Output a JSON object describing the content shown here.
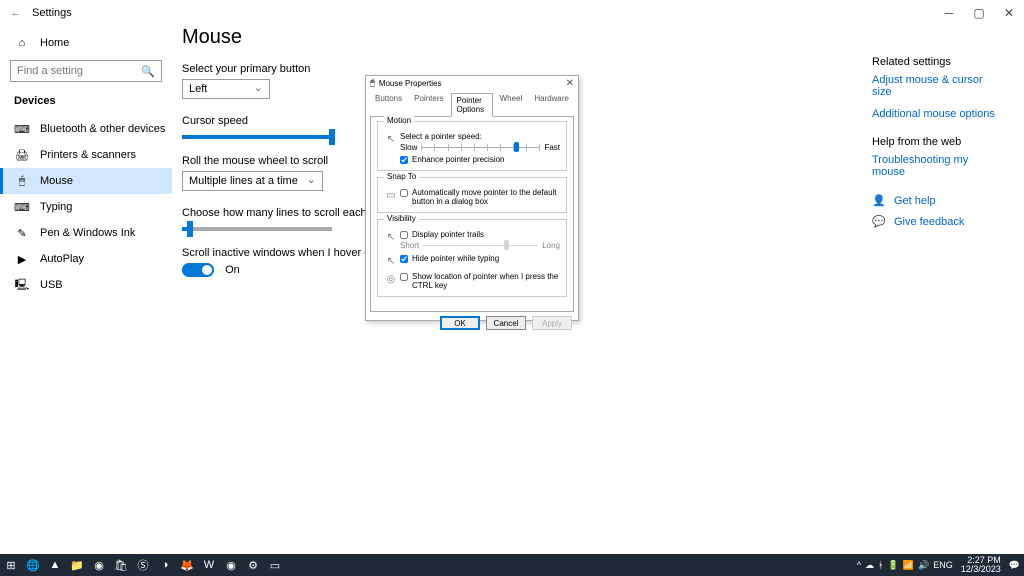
{
  "titlebar": {
    "title": "Settings"
  },
  "sidebar": {
    "home": "Home",
    "search_placeholder": "Find a setting",
    "section": "Devices",
    "items": [
      {
        "label": "Bluetooth & other devices",
        "icon": "⌨"
      },
      {
        "label": "Printers & scanners",
        "icon": "🖨"
      },
      {
        "label": "Mouse",
        "icon": "🖱",
        "active": true
      },
      {
        "label": "Typing",
        "icon": "⌨"
      },
      {
        "label": "Pen & Windows Ink",
        "icon": "✎"
      },
      {
        "label": "AutoPlay",
        "icon": "▶"
      },
      {
        "label": "USB",
        "icon": "🖳"
      }
    ]
  },
  "main": {
    "heading": "Mouse",
    "primary_btn_label": "Select your primary button",
    "primary_btn_value": "Left",
    "cursor_speed_label": "Cursor speed",
    "cursor_speed_value": 98,
    "scroll_wheel_label": "Roll the mouse wheel to scroll",
    "scroll_wheel_value": "Multiple lines at a time",
    "lines_label": "Choose how many lines to scroll each time",
    "lines_value": 3,
    "inactive_label": "Scroll inactive windows when I hover over them",
    "inactive_on": "On"
  },
  "right": {
    "related_head": "Related settings",
    "adjust_link": "Adjust mouse & cursor size",
    "additional_link": "Additional mouse options",
    "help_head": "Help from the web",
    "troubleshoot": "Troubleshooting my mouse",
    "get_help": "Get help",
    "feedback": "Give feedback"
  },
  "dialog": {
    "title": "Mouse Properties",
    "tabs": [
      "Buttons",
      "Pointers",
      "Pointer Options",
      "Wheel",
      "Hardware"
    ],
    "active_tab": 2,
    "motion": {
      "legend": "Motion",
      "select_label": "Select a pointer speed:",
      "slow": "Slow",
      "fast": "Fast",
      "speed_pct": 78,
      "enhance": "Enhance pointer precision",
      "enhance_checked": true
    },
    "snap": {
      "legend": "Snap To",
      "auto": "Automatically move pointer to the default button in a dialog box",
      "auto_checked": false
    },
    "visibility": {
      "legend": "Visibility",
      "trails": "Display pointer trails",
      "trails_checked": false,
      "short": "Short",
      "long": "Long",
      "trails_pct": 70,
      "hide": "Hide pointer while typing",
      "hide_checked": true,
      "ctrl": "Show location of pointer when I press the CTRL key",
      "ctrl_checked": false
    },
    "ok": "OK",
    "cancel": "Cancel",
    "apply": "Apply"
  },
  "tray": {
    "lang": "ENG",
    "time": "2:27 PM",
    "date": "12/3/2023"
  }
}
